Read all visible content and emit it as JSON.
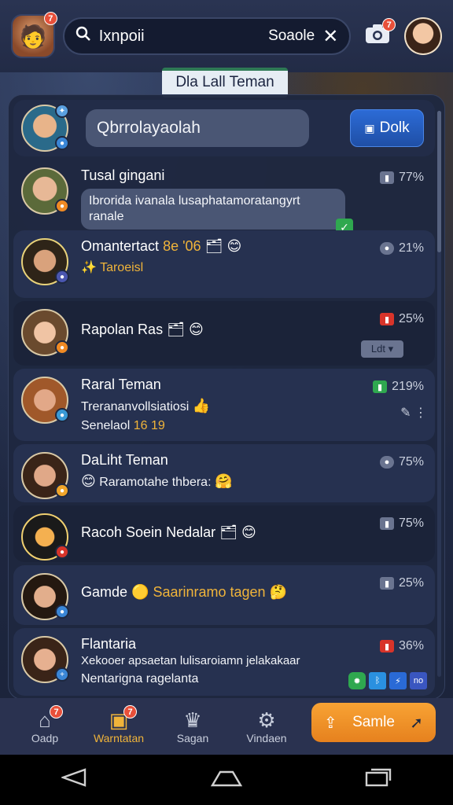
{
  "header": {
    "search_query": "Ixnpoii",
    "search_label": "Soaole",
    "clear_label": "✕",
    "profile_badge": "7",
    "camera_badge": "7"
  },
  "tab": {
    "label": "Dla Lall Teman"
  },
  "compose": {
    "input_text": "Qbrrolayaolah",
    "send_label": "Dolk"
  },
  "chats": [
    {
      "name": "Tusal gingani",
      "message": "Ibrorida ivanala lusaphatamoratangyrt ranale",
      "percent": "77%"
    },
    {
      "name": "Omantertact",
      "name_extra": "8e '06",
      "sub": "Taroeisl",
      "percent": "21%"
    },
    {
      "name": "Rapolan Ras",
      "percent": "25%",
      "button": "Ldt ▾"
    },
    {
      "name": "Raral Teman",
      "sub1": "Trerananvollsiatiosi",
      "sub2": "Senelaol",
      "sub2_gold": "16 19",
      "percent": "219%"
    },
    {
      "name": "DaLiht Teman",
      "sub": "Raramotahe thbera:",
      "percent": "75%"
    },
    {
      "name": "Racoh Soein Nedalar",
      "percent": "75%"
    },
    {
      "name": "Gamde",
      "name_extra": "Saarinramo tagen",
      "percent": "25%"
    },
    {
      "name": "Flantaria",
      "sub1": "Xekooer apsaetan lulisaroiamn jelakakaar",
      "sub2": "Nentarigna ragelanta",
      "percent": "36%",
      "tags": "no"
    }
  ],
  "nav": {
    "items": [
      {
        "label": "Oadp",
        "badge": "7"
      },
      {
        "label": "Warntatan",
        "badge": "7"
      },
      {
        "label": "Sagan"
      },
      {
        "label": "Vindaen"
      }
    ],
    "cta_label": "Samle"
  },
  "colors": {
    "accent": "#f0b43a",
    "cta": "#f8a334",
    "send": "#2c6bd6"
  }
}
